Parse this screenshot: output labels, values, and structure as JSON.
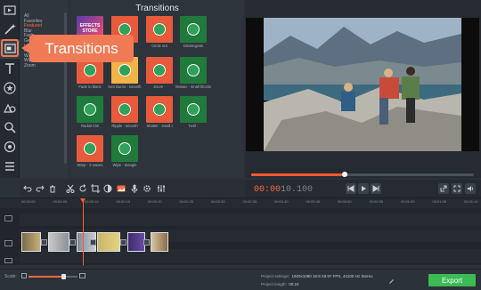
{
  "panel": {
    "title": "Transitions"
  },
  "callout": {
    "text": "Transitions"
  },
  "categories": [
    "All",
    "Favorites",
    "Featured",
    "Blur",
    "Fade",
    "Geometric",
    "Lines",
    "Mosaic",
    "Warp",
    "Wipe",
    "Zoom"
  ],
  "selected_category": "Featured",
  "transitions": [
    {
      "label": "",
      "badge": "EFFECTS STORE"
    },
    {
      "label": "",
      "badge": ""
    },
    {
      "label": "Circle out",
      "badge": ""
    },
    {
      "label": "Disintegrate",
      "badge": ""
    },
    {
      "label": "Fade to black",
      "badge": ""
    },
    {
      "label": "Ken Burns - smooth",
      "badge": ""
    },
    {
      "label": "Zoom -",
      "badge": ""
    },
    {
      "label": "Mosaic - small blocks",
      "badge": ""
    },
    {
      "label": "Radial CW",
      "badge": ""
    },
    {
      "label": "Ripple - smooth",
      "badge": ""
    },
    {
      "label": "Shatter - small I",
      "badge": ""
    },
    {
      "label": "Twirl -",
      "badge": ""
    },
    {
      "label": "Warp - 2 waves",
      "badge": ""
    },
    {
      "label": "Wipe - triangle",
      "badge": ""
    }
  ],
  "player": {
    "time_current": "00:00",
    "time_ms": "10.100",
    "progress_fraction": 0.42
  },
  "timeline": {
    "ticks": [
      "00:00:00",
      "00:00:05",
      "00:00:10",
      "00:00:15",
      "00:00:20",
      "00:00:25",
      "00:00:30",
      "00:00:35",
      "00:00:40",
      "00:00:45",
      "00:00:50",
      "00:00:55",
      "00:01:00",
      "00:01:05",
      "00:01:10"
    ]
  },
  "bottom": {
    "scale_label": "Scale:",
    "settings_label": "Project settings:",
    "settings_value": "1920x1080 16:9 29.97 FPS, 44100 Hz Stereo",
    "length_label": "Project length:",
    "length_value": "00:24",
    "export_label": "Export"
  },
  "colors": {
    "accent": "#ff6a3d",
    "callout": "#ef7a55",
    "export": "#3cba54"
  }
}
